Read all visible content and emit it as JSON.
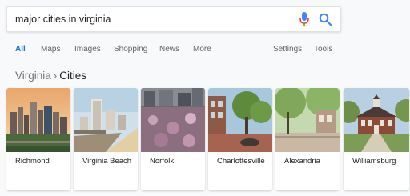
{
  "search": {
    "query": "major cities in virginia"
  },
  "tabs": [
    {
      "label": "All",
      "active": true
    },
    {
      "label": "Maps"
    },
    {
      "label": "Images"
    },
    {
      "label": "Shopping"
    },
    {
      "label": "News"
    },
    {
      "label": "More"
    }
  ],
  "tools": {
    "settings": "Settings",
    "tools": "Tools"
  },
  "breadcrumb": {
    "parent": "Virginia",
    "separator": "›",
    "current": "Cities"
  },
  "cities": [
    {
      "name": "Richmond"
    },
    {
      "name": "Virginia Beach"
    },
    {
      "name": "Norfolk"
    },
    {
      "name": "Charlottesville"
    },
    {
      "name": "Alexandria"
    },
    {
      "name": "Williamsburg"
    }
  ],
  "colors": {
    "accent": "#1a73e8",
    "mic_red": "#ea4335",
    "mic_blue": "#4285f4"
  }
}
